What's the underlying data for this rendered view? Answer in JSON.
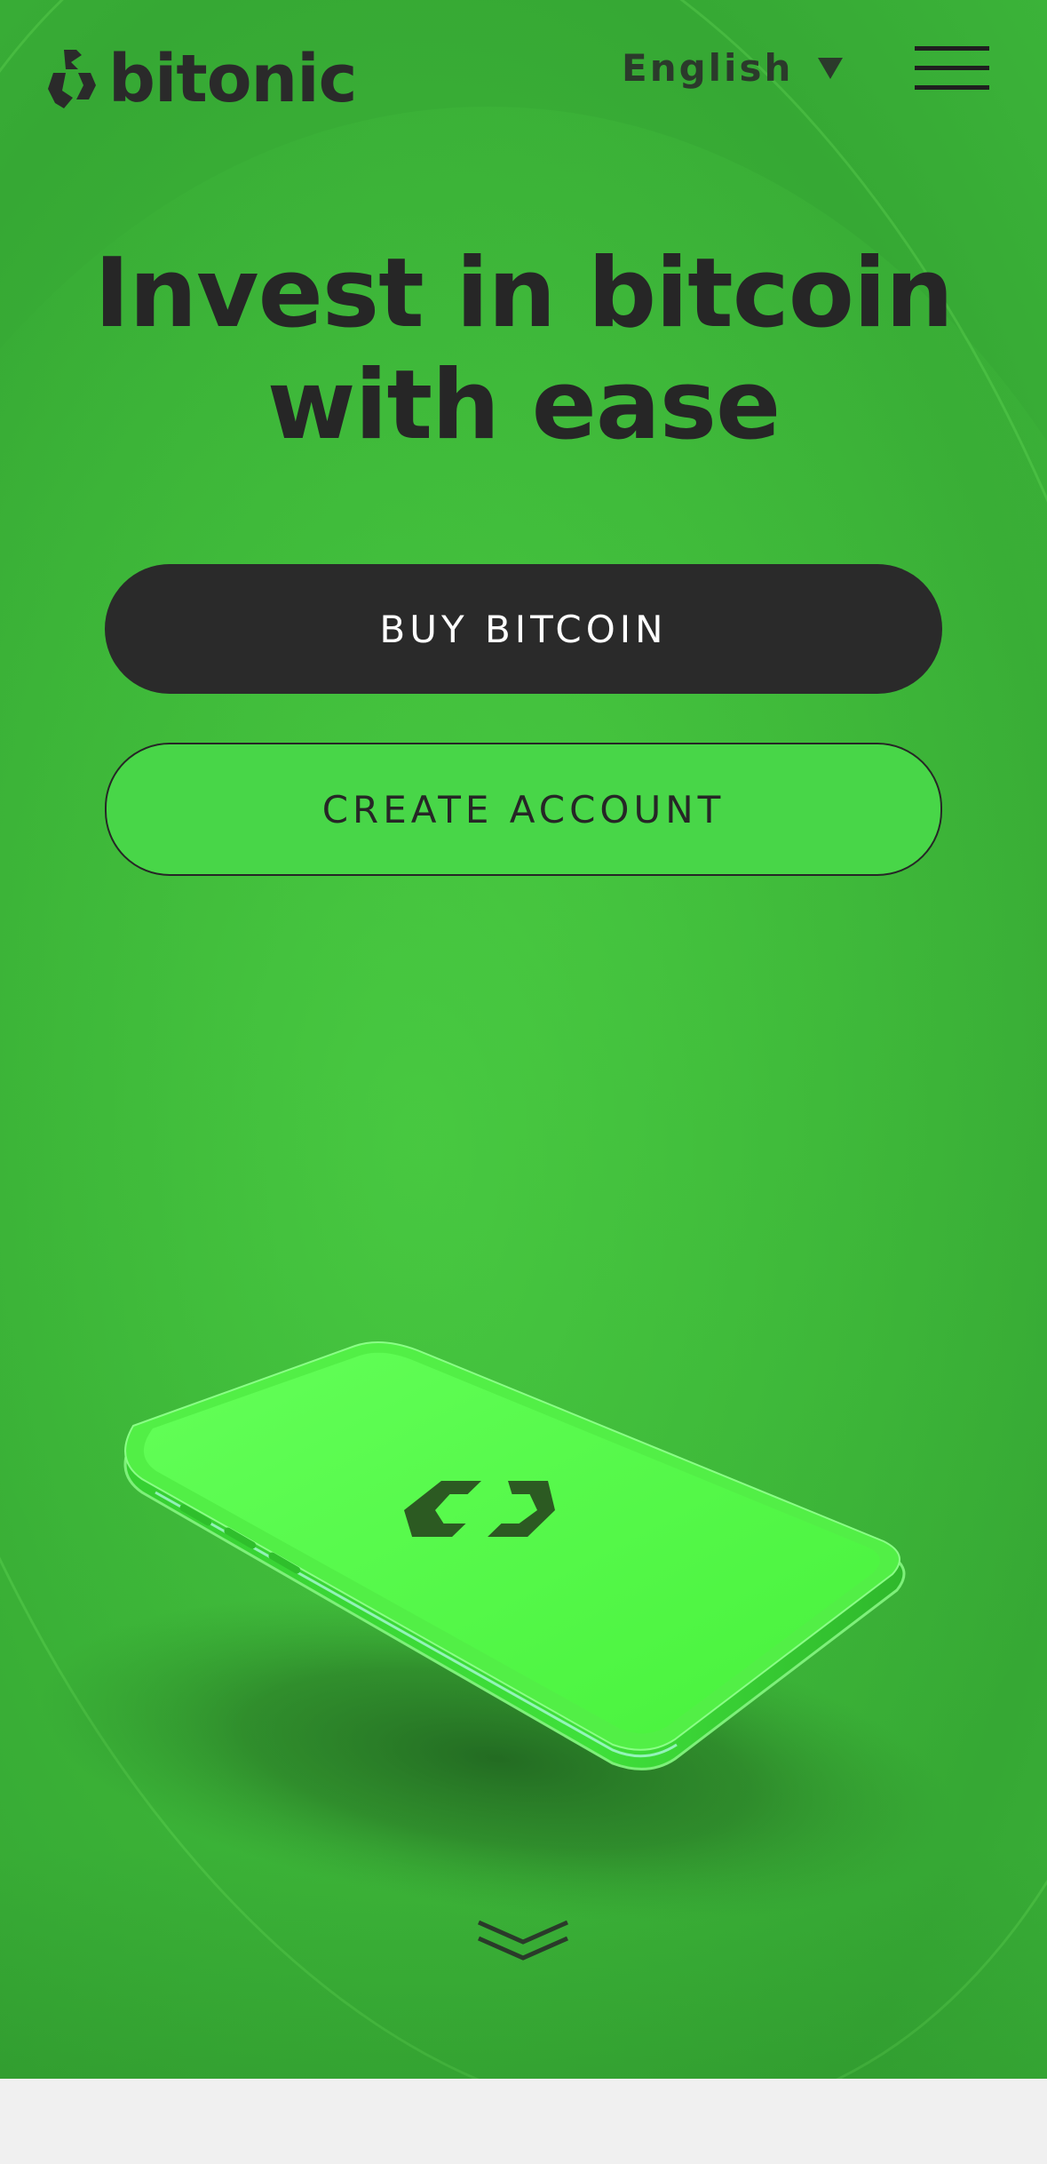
{
  "brand": {
    "name": "bitonic",
    "logo_icon": "bitonic-logo-icon"
  },
  "header": {
    "language": "English",
    "language_icon": "triangle-down-icon",
    "menu_icon": "hamburger-menu-icon"
  },
  "hero": {
    "headline_line1": "Invest in bitcoin",
    "headline_line2": "with ease",
    "primary_button": "BUY BITCOIN",
    "secondary_button": "CREATE ACCOUNT",
    "illustration": "phone-with-bitonic-logo-illustration",
    "scroll_icon": "double-chevron-down-icon"
  },
  "colors": {
    "hero_background": "#3cb538",
    "primary_button": "#2a2a2a",
    "secondary_button": "#48d648",
    "text_dark": "#262626",
    "phone_screen": "#5cff4e"
  }
}
